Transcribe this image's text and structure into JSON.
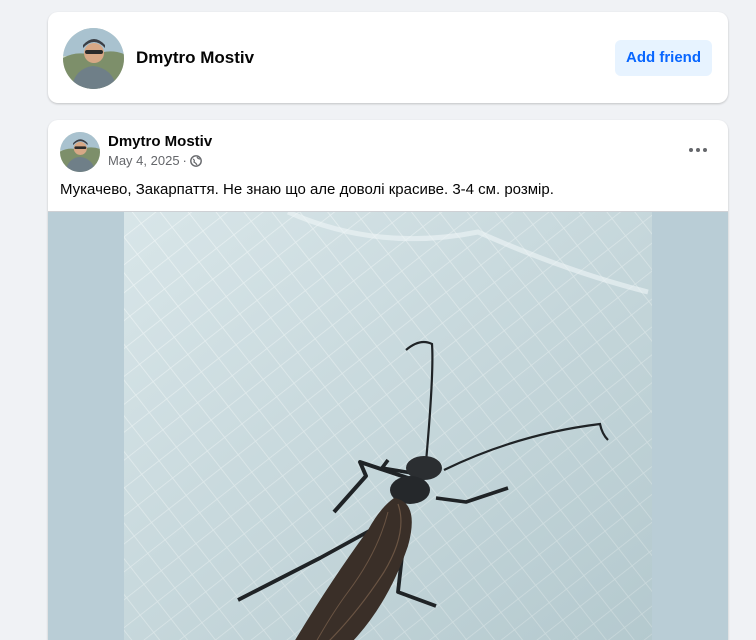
{
  "profile": {
    "name": "Dmytro Mostiv",
    "add_friend_label": "Add friend"
  },
  "post": {
    "author": "Dmytro Mostiv",
    "date": "May 4, 2025",
    "separator": "·",
    "privacy_icon": "globe-icon",
    "menu_icon": "more-options-icon",
    "text": "Мукачево, Закарпаття.  Не знаю що але доволі красиве.  3-4 см. розмір."
  },
  "colors": {
    "accent": "#0866ff",
    "accent_bg": "#e7f3ff",
    "page_bg": "#f0f2f5",
    "image_bg": "#b9cdd6"
  }
}
